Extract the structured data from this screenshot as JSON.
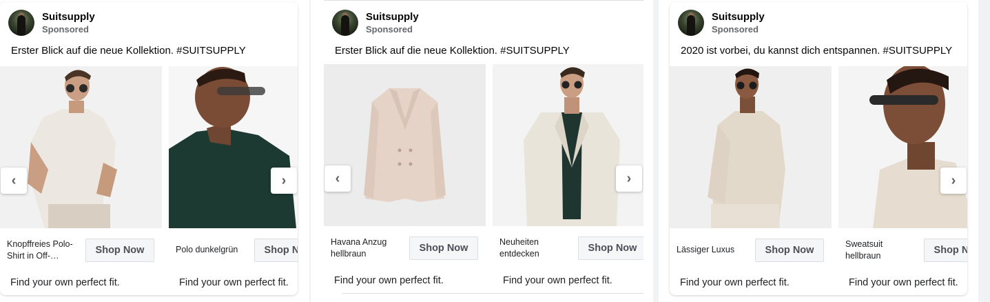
{
  "ads": [
    {
      "brand": "Suitsupply",
      "sponsored": "Sponsored",
      "caption": "Erster Blick auf die neue Kollektion. #SUITSUPPLY",
      "items": [
        {
          "title": "Knopffreies Polo-Shirt in Off-…",
          "cta": "Shop Now",
          "description": "Find your own perfect fit."
        },
        {
          "title": "Polo dunkelgrün",
          "cta": "Shop Now",
          "description": "Find your own perfect fit."
        }
      ],
      "arrows": {
        "prev": "‹",
        "next": "›"
      }
    },
    {
      "brand": "Suitsupply",
      "sponsored": "Sponsored",
      "caption": "Erster Blick auf die neue Kollektion. #SUITSUPPLY",
      "items": [
        {
          "title": "Havana Anzug hellbraun",
          "cta": "Shop Now",
          "description": "Find your own perfect fit."
        },
        {
          "title": "Neuheiten entdecken",
          "cta": "Shop Now",
          "description": "Find your own perfect fit."
        }
      ],
      "arrows": {
        "prev": "‹",
        "next": "›"
      }
    },
    {
      "brand": "Suitsupply",
      "sponsored": "Sponsored",
      "caption": "2020 ist vorbei, du kannst dich entspannen. #SUITSUPPLY",
      "items": [
        {
          "title": "Lässiger Luxus",
          "cta": "Shop Now",
          "description": "Find your own perfect fit."
        },
        {
          "title": "Sweatsuit hellbraun",
          "cta": "Shop Now",
          "description": "Find your own perfect fit."
        }
      ],
      "arrows": {
        "next": "›"
      }
    }
  ],
  "icons": {
    "avatar": "suitsupply-avatar-icon",
    "prev": "chevron-left-icon",
    "next": "chevron-right-icon"
  }
}
